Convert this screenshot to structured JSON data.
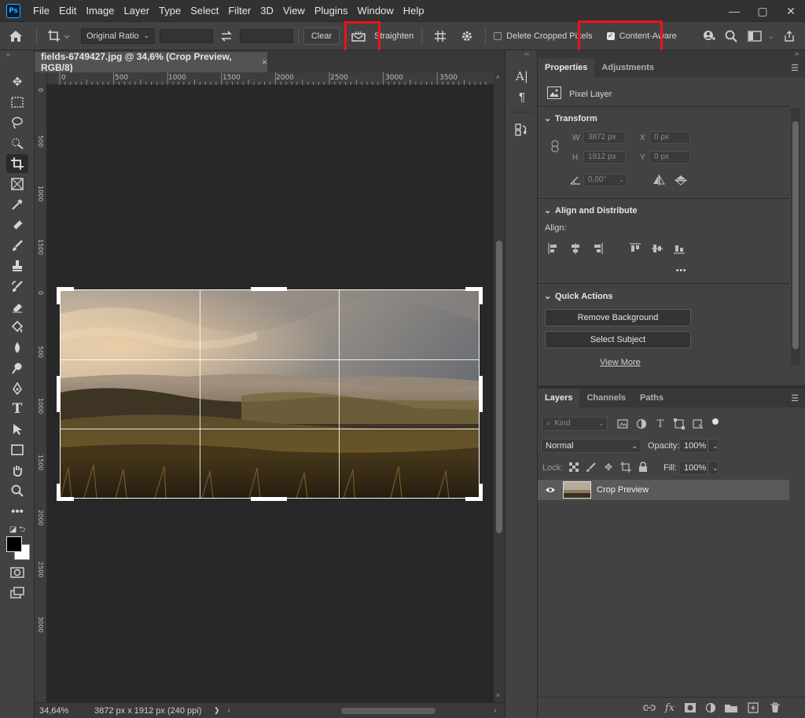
{
  "app": {
    "logo": "Ps",
    "menu": [
      "File",
      "Edit",
      "Image",
      "Layer",
      "Type",
      "Select",
      "Filter",
      "3D",
      "View",
      "Plugins",
      "Window",
      "Help"
    ],
    "window_controls": [
      "—",
      "▢",
      "✕"
    ]
  },
  "options_bar": {
    "ratio_select": "Original Ratio",
    "clear_label": "Clear",
    "straighten_label": "Straighten",
    "delete_cropped_label": "Delete Cropped Pixels",
    "delete_cropped_checked": false,
    "content_aware_label": "Content-Aware",
    "content_aware_checked": true,
    "highlight_color": "#e8141c"
  },
  "document": {
    "tab_title": "fields-6749427.jpg @ 34,6% (Crop Preview, RGB/8)",
    "close_label": "×",
    "ruler_top_labels": [
      "0",
      "500",
      "1000",
      "1500",
      "2000",
      "2500",
      "3000",
      "3500"
    ],
    "ruler_left_labels": [
      "0",
      "500",
      "1000",
      "1500",
      "0",
      "500",
      "1000",
      "1500",
      "2000",
      "2500",
      "3000"
    ],
    "zoom": "34,64%",
    "doc_info": "3872 px x 1912 px (240 ppi)",
    "status_arrow": "❯"
  },
  "properties_panel": {
    "tabs": [
      "Properties",
      "Adjustments"
    ],
    "active_tab": "Properties",
    "layer_type": "Pixel Layer",
    "transform": {
      "title": "Transform",
      "w_label": "W",
      "w_value": "3872 px",
      "h_label": "H",
      "h_value": "1912 px",
      "x_label": "X",
      "x_value": "0 px",
      "y_label": "Y",
      "y_value": "0 px",
      "angle_value": "0,00°"
    },
    "align": {
      "title": "Align and Distribute",
      "align_label": "Align:",
      "more": "•••"
    },
    "quick_actions": {
      "title": "Quick Actions",
      "remove_bg": "Remove Background",
      "select_subject": "Select Subject",
      "view_more": "View More"
    }
  },
  "layers_panel": {
    "tabs": [
      "Layers",
      "Channels",
      "Paths"
    ],
    "active_tab": "Layers",
    "kind_placeholder": "Kind",
    "blend_mode": "Normal",
    "opacity_label": "Opacity:",
    "opacity_value": "100%",
    "lock_label": "Lock:",
    "fill_label": "Fill:",
    "fill_value": "100%",
    "layer_name": "Crop Preview"
  }
}
